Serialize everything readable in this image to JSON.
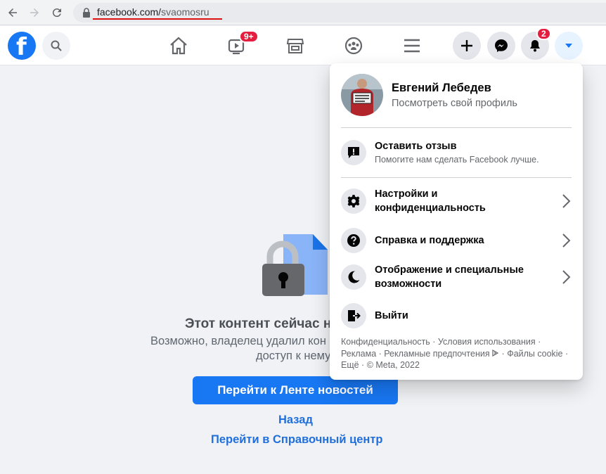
{
  "browser": {
    "url_domain": "facebook.com/",
    "url_path": "svaomosru"
  },
  "topbar": {
    "logo": "f",
    "video_badge": "9+",
    "notifications_badge": "2"
  },
  "main": {
    "title": "Этот контент сейчас н",
    "desc_line1": "Возможно, владелец удалил кон",
    "desc_line2": "доступ к нему",
    "button": "Перейти к Ленте новостей",
    "back_link": "Назад",
    "help_link": "Перейти в Справочный центр"
  },
  "menu": {
    "profile": {
      "name": "Евгений Лебедев",
      "subtitle": "Посмотреть свой профиль"
    },
    "feedback": {
      "label": "Оставить отзыв",
      "subtitle": "Помогите нам сделать Facebook лучше."
    },
    "items": [
      {
        "label_line1": "Настройки и",
        "label_line2": "конфиденциальность",
        "icon": "gear-icon"
      },
      {
        "label_line1": "Справка и поддержка",
        "label_line2": "",
        "icon": "help-icon"
      },
      {
        "label_line1": "Отображение и специальные",
        "label_line2": "возможности",
        "icon": "moon-icon"
      },
      {
        "label_line1": "Выйти",
        "label_line2": "",
        "icon": "logout-icon"
      }
    ],
    "footer": {
      "privacy": "Конфиденциальность",
      "terms": "Условия использования",
      "ads": "Реклама",
      "ad_choices": "Рекламные предпочтения",
      "cookies": "Файлы cookie",
      "more": "Ещё",
      "copyright": "© Meta, 2022"
    }
  },
  "colors": {
    "brand": "#1877f2",
    "badge": "#e41e3f",
    "link": "#216fdb"
  }
}
